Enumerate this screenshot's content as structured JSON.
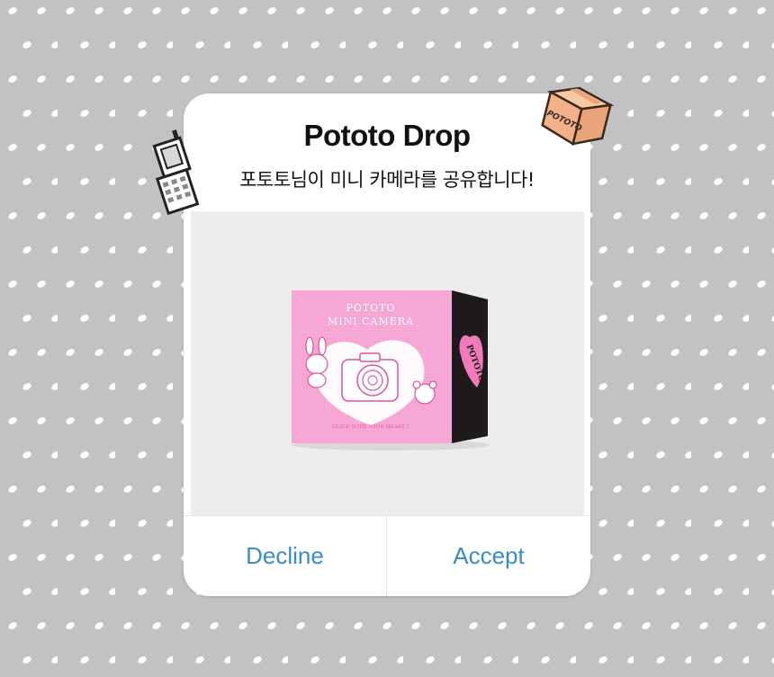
{
  "dialog": {
    "title": "Pototo Drop",
    "subtitle": "포토토님이 미니 카메라를 공유합니다!",
    "decline_label": "Decline",
    "accept_label": "Accept"
  },
  "product_box": {
    "brand_line1": "POTOTO",
    "brand_line2": "MINI CAMERA",
    "tagline": "CLICK WITH YOUR HEART !",
    "side_label": "POTOTO"
  },
  "sticker_box": {
    "label": "POTOTO"
  },
  "icons": {
    "phone": "flip-phone-icon",
    "box": "cardboard-box-icon"
  },
  "colors": {
    "background": "#c2c2c4",
    "accent": "#3a8dc4",
    "box_pink": "#f6a9d6",
    "box_side": "#1e1a1c"
  }
}
